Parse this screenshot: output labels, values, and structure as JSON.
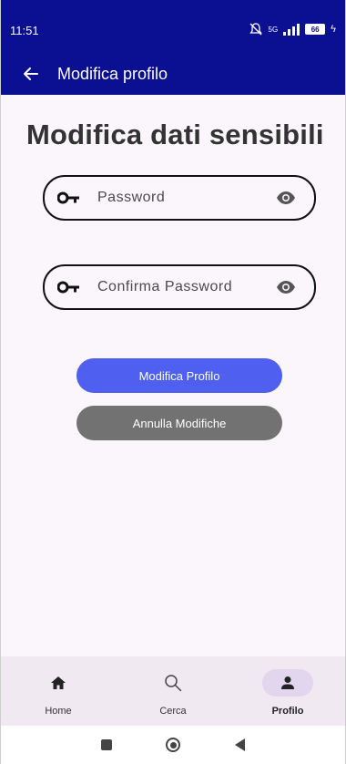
{
  "status_bar": {
    "time": "11:51",
    "network": "5G",
    "battery": "66"
  },
  "app_bar": {
    "title": "Modifica profilo",
    "back_icon": "arrow-left-icon"
  },
  "main": {
    "heading": "Modifica dati sensibili",
    "password_field": {
      "placeholder": "Password",
      "value": "",
      "icon": "key-icon",
      "toggle_icon": "eye-icon"
    },
    "confirm_field": {
      "placeholder": "Confirma Password",
      "value": "",
      "icon": "key-icon",
      "toggle_icon": "eye-icon"
    },
    "primary_button": "Modifica Profilo",
    "secondary_button": "Annulla Modifiche"
  },
  "bottom_nav": {
    "items": [
      {
        "label": "Home",
        "icon": "home-icon",
        "active": false
      },
      {
        "label": "Cerca",
        "icon": "search-icon",
        "active": false
      },
      {
        "label": "Profilo",
        "icon": "person-icon",
        "active": true
      }
    ]
  },
  "colors": {
    "app_bar": "#0b0f92",
    "primary_button": "#4f5ff0",
    "secondary_button": "#727272",
    "background": "#fbf6fb",
    "nav_background": "#f0e9f2",
    "nav_active": "#e2d6ef"
  }
}
